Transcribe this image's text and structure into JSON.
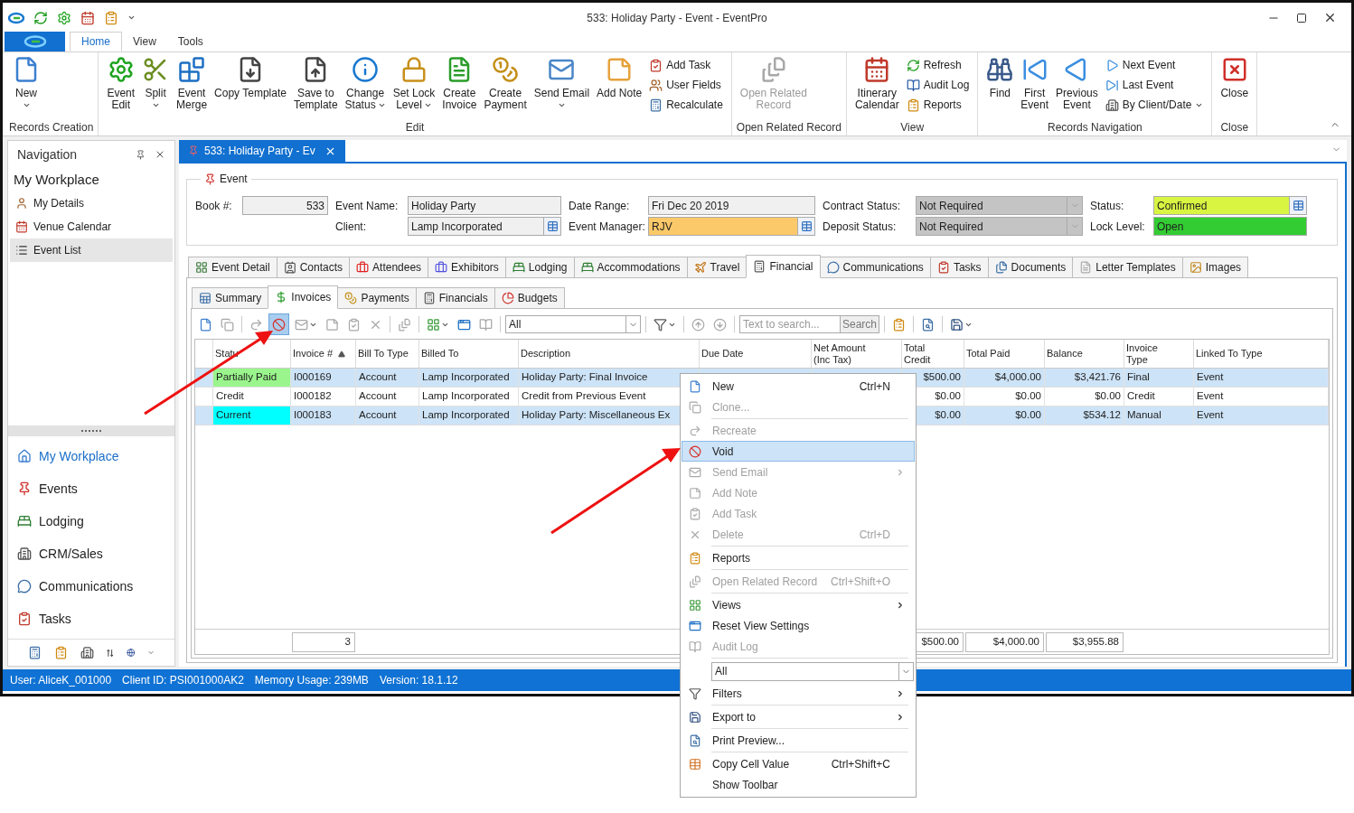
{
  "window": {
    "title": "533: Holiday Party - Event - EventPro"
  },
  "ribbon_tabs": [
    {
      "label": "Home",
      "selected": true
    },
    {
      "label": "View",
      "selected": false
    },
    {
      "label": "Tools",
      "selected": false
    }
  ],
  "ribbon_groups": [
    {
      "label": "Records Creation",
      "buttons": [
        {
          "kind": "large",
          "label": "New",
          "dropdown": true,
          "disabled": false
        }
      ]
    },
    {
      "label": "Edit",
      "buttons": [
        {
          "kind": "large",
          "label": "Event\nEdit",
          "dropdown": false,
          "disabled": false
        },
        {
          "kind": "large",
          "label": "Split",
          "dropdown": true,
          "disabled": false
        },
        {
          "kind": "large",
          "label": "Event\nMerge",
          "dropdown": false,
          "disabled": false
        },
        {
          "kind": "large",
          "label": "Copy Template",
          "dropdown": false,
          "disabled": false
        },
        {
          "kind": "large",
          "label": "Save to\nTemplate",
          "dropdown": false,
          "disabled": false
        },
        {
          "kind": "large",
          "label": "Change\nStatus",
          "dropdown": true,
          "disabled": false
        },
        {
          "kind": "large",
          "label": "Set Lock\nLevel",
          "dropdown": true,
          "disabled": false
        },
        {
          "kind": "large",
          "label": "Create\nInvoice",
          "dropdown": false,
          "disabled": false
        },
        {
          "kind": "large",
          "label": "Create\nPayment",
          "dropdown": false,
          "disabled": false
        },
        {
          "kind": "large",
          "label": "Send Email",
          "dropdown": true,
          "disabled": false
        },
        {
          "kind": "large",
          "label": "Add Note",
          "dropdown": false,
          "disabled": false
        },
        {
          "kind": "stack",
          "items": [
            {
              "label": "Add Task",
              "dropdown": false
            },
            {
              "label": "User Fields",
              "dropdown": false
            },
            {
              "label": "Recalculate",
              "dropdown": false
            }
          ]
        }
      ]
    },
    {
      "label": "Open Related Record",
      "buttons": [
        {
          "kind": "large",
          "label": "Open Related\nRecord",
          "dropdown": false,
          "disabled": true
        }
      ]
    },
    {
      "label": "View",
      "buttons": [
        {
          "kind": "large",
          "label": "Itinerary\nCalendar",
          "dropdown": false,
          "disabled": false
        },
        {
          "kind": "stack",
          "items": [
            {
              "label": "Refresh",
              "dropdown": false
            },
            {
              "label": "Audit Log",
              "dropdown": false
            },
            {
              "label": "Reports",
              "dropdown": false
            }
          ]
        }
      ]
    },
    {
      "label": "Records Navigation",
      "buttons": [
        {
          "kind": "large",
          "label": "Find",
          "dropdown": false,
          "disabled": false
        },
        {
          "kind": "large",
          "label": "First\nEvent",
          "dropdown": false,
          "disabled": false
        },
        {
          "kind": "large",
          "label": "Previous\nEvent",
          "dropdown": false,
          "disabled": false
        },
        {
          "kind": "stack",
          "items": [
            {
              "label": "Next Event",
              "dropdown": false
            },
            {
              "label": "Last Event",
              "dropdown": false
            },
            {
              "label": "By Client/Date",
              "dropdown": true
            }
          ]
        }
      ]
    },
    {
      "label": "Close",
      "buttons": [
        {
          "kind": "large",
          "label": "Close",
          "dropdown": false,
          "disabled": false
        }
      ]
    }
  ],
  "navigation": {
    "title": "Navigation",
    "heading": "My Workplace",
    "items": [
      {
        "label": "My Details",
        "selected": false
      },
      {
        "label": "Venue Calendar",
        "selected": false
      },
      {
        "label": "Event List",
        "selected": true
      }
    ],
    "modules": [
      {
        "label": "My Workplace",
        "selected": true
      },
      {
        "label": "Events",
        "selected": false
      },
      {
        "label": "Lodging",
        "selected": false
      },
      {
        "label": "CRM/Sales",
        "selected": false
      },
      {
        "label": "Communications",
        "selected": false
      },
      {
        "label": "Tasks",
        "selected": false
      }
    ]
  },
  "document_tab": {
    "label": "533: Holiday Party - Ev"
  },
  "event": {
    "legend": "Event",
    "fields": [
      {
        "label": "Book #:",
        "value": "533",
        "kind": "readonly"
      },
      {
        "label": "Event Name:",
        "value": "Holiday Party",
        "kind": "text"
      },
      {
        "label": "Date Range:",
        "value": "Fri Dec 20 2019",
        "kind": "text"
      },
      {
        "label": "Contract Status:",
        "value": "Not Required",
        "kind": "dropdown"
      },
      {
        "label": "Status:",
        "value": "Confirmed",
        "kind": "lookup",
        "color": "#d9f542"
      },
      {
        "label": "Client:",
        "value": "Lamp Incorporated",
        "kind": "lookup"
      },
      {
        "label": "Event Manager:",
        "value": "RJV",
        "kind": "lookup",
        "color": "#fcc96a"
      },
      {
        "label": "Deposit Status:",
        "value": "Not Required",
        "kind": "dropdown"
      },
      {
        "label": "Lock Level:",
        "value": "Open",
        "kind": "text",
        "color": "#33cc33"
      }
    ]
  },
  "tabs": [
    {
      "label": "Event Detail",
      "selected": false
    },
    {
      "label": "Contacts",
      "selected": false
    },
    {
      "label": "Attendees",
      "selected": false
    },
    {
      "label": "Exhibitors",
      "selected": false
    },
    {
      "label": "Lodging",
      "selected": false
    },
    {
      "label": "Accommodations",
      "selected": false
    },
    {
      "label": "Travel",
      "selected": false
    },
    {
      "label": "Financial",
      "selected": true
    },
    {
      "label": "Communications",
      "selected": false
    },
    {
      "label": "Tasks",
      "selected": false
    },
    {
      "label": "Documents",
      "selected": false
    },
    {
      "label": "Letter Templates",
      "selected": false
    },
    {
      "label": "Images",
      "selected": false
    }
  ],
  "sub_tabs": [
    {
      "label": "Summary",
      "selected": false
    },
    {
      "label": "Invoices",
      "selected": true
    },
    {
      "label": "Payments",
      "selected": false
    },
    {
      "label": "Financials",
      "selected": false
    },
    {
      "label": "Budgets",
      "selected": false
    }
  ],
  "toolbar": [
    {
      "kind": "button",
      "pressed": false,
      "disabled": false,
      "dropdown": false
    },
    {
      "kind": "button",
      "pressed": false,
      "disabled": true,
      "dropdown": false
    },
    {
      "kind": "separator"
    },
    {
      "kind": "button",
      "pressed": false,
      "disabled": true,
      "dropdown": false
    },
    {
      "kind": "button",
      "pressed": true,
      "disabled": false,
      "dropdown": false
    },
    {
      "kind": "button",
      "pressed": false,
      "disabled": true,
      "dropdown": true
    },
    {
      "kind": "button",
      "pressed": false,
      "disabled": true,
      "dropdown": false
    },
    {
      "kind": "button",
      "pressed": false,
      "disabled": true,
      "dropdown": false
    },
    {
      "kind": "button",
      "pressed": false,
      "disabled": true,
      "dropdown": false
    },
    {
      "kind": "separator"
    },
    {
      "kind": "button",
      "pressed": false,
      "disabled": true,
      "dropdown": false
    },
    {
      "kind": "separator"
    },
    {
      "kind": "button",
      "pressed": false,
      "disabled": false,
      "dropdown": true
    },
    {
      "kind": "button",
      "pressed": false,
      "disabled": false,
      "dropdown": false
    },
    {
      "kind": "button",
      "pressed": false,
      "disabled": true,
      "dropdown": false
    },
    {
      "kind": "separator"
    },
    {
      "kind": "combo",
      "value": "All"
    },
    {
      "kind": "separator"
    },
    {
      "kind": "button",
      "pressed": false,
      "disabled": false,
      "dropdown": true
    },
    {
      "kind": "separator"
    },
    {
      "kind": "button",
      "pressed": false,
      "disabled": true,
      "dropdown": false
    },
    {
      "kind": "button",
      "pressed": false,
      "disabled": true,
      "dropdown": false
    },
    {
      "kind": "separator"
    },
    {
      "kind": "search",
      "placeholder": "Text to search...",
      "button": "Search"
    },
    {
      "kind": "separator"
    },
    {
      "kind": "button",
      "pressed": false,
      "disabled": false,
      "dropdown": false
    },
    {
      "kind": "separator"
    },
    {
      "kind": "button",
      "pressed": false,
      "disabled": false,
      "dropdown": false
    },
    {
      "kind": "separator"
    },
    {
      "kind": "button",
      "pressed": false,
      "disabled": false,
      "dropdown": true
    }
  ],
  "table": {
    "columns": [
      {
        "label": "Statu",
        "sorted": false
      },
      {
        "label": "Invoice #",
        "sorted": true
      },
      {
        "label": "Bill To Type",
        "sorted": false
      },
      {
        "label": "Billed To",
        "sorted": false
      },
      {
        "label": "Description",
        "sorted": false
      },
      {
        "label": "Due Date",
        "sorted": false
      },
      {
        "label": "Net Amount\n(Inc Tax)",
        "sorted": false
      },
      {
        "label": "Total\nCredit",
        "sorted": false
      },
      {
        "label": "Total Paid",
        "sorted": false
      },
      {
        "label": "Balance",
        "sorted": false
      },
      {
        "label": "Invoice\nType",
        "sorted": false
      },
      {
        "label": "Linked To Type",
        "sorted": false
      }
    ],
    "rows": [
      {
        "selected": true,
        "color": "#9af58c",
        "cells": [
          "Partially Paid",
          "I000169",
          "Account",
          "Lamp Incorporated",
          "Holiday Party: Final Invoice",
          null,
          null,
          "$500.00",
          "$4,000.00",
          "$3,421.76",
          "Final",
          "Event"
        ]
      },
      {
        "selected": false,
        "cells": [
          "Credit",
          "I000182",
          "Account",
          "Lamp Incorporated",
          "Credit from Previous Event",
          null,
          null,
          "$0.00",
          "$0.00",
          "$0.00",
          "Credit",
          "Event"
        ]
      },
      {
        "selected": true,
        "color": "#00ffff",
        "cells": [
          "Current",
          "I000183",
          "Account",
          "Lamp Incorporated",
          "Holiday Party: Miscellaneous Ex",
          null,
          null,
          "$0.00",
          "$0.00",
          "$534.12",
          "Manual",
          "Event"
        ]
      }
    ],
    "footer": {
      "count": "3",
      "total_credit": "$500.00",
      "total_paid": "$4,000.00",
      "balance": "$3,955.88"
    }
  },
  "status_bar": [
    "User: AliceK_001000",
    "Client ID: PSI001000AK2",
    "Memory Usage: 239MB",
    "Version: 18.1.12"
  ],
  "context_menu": [
    {
      "kind": "item",
      "label": "New",
      "shortcut": "Ctrl+N",
      "disabled": false,
      "selected": false,
      "submenu": false
    },
    {
      "kind": "item",
      "label": "Clone...",
      "disabled": true,
      "selected": false,
      "submenu": false
    },
    {
      "kind": "separator"
    },
    {
      "kind": "item",
      "label": "Recreate",
      "disabled": true,
      "selected": false,
      "submenu": false
    },
    {
      "kind": "item",
      "label": "Void",
      "disabled": false,
      "selected": true,
      "submenu": false
    },
    {
      "kind": "item",
      "label": "Send Email",
      "disabled": true,
      "selected": false,
      "submenu": true
    },
    {
      "kind": "item",
      "label": "Add Note",
      "disabled": true,
      "selected": false,
      "submenu": false
    },
    {
      "kind": "item",
      "label": "Add Task",
      "disabled": true,
      "selected": false,
      "submenu": false
    },
    {
      "kind": "item",
      "label": "Delete",
      "shortcut": "Ctrl+D",
      "disabled": true,
      "selected": false,
      "submenu": false
    },
    {
      "kind": "separator"
    },
    {
      "kind": "item",
      "label": "Reports",
      "disabled": false,
      "selected": false,
      "submenu": false
    },
    {
      "kind": "separator"
    },
    {
      "kind": "item",
      "label": "Open Related Record",
      "shortcut": "Ctrl+Shift+O",
      "disabled": true,
      "selected": false,
      "submenu": false
    },
    {
      "kind": "separator"
    },
    {
      "kind": "item",
      "label": "Views",
      "disabled": false,
      "selected": false,
      "submenu": true
    },
    {
      "kind": "item",
      "label": "Reset View Settings",
      "disabled": false,
      "selected": false,
      "submenu": false
    },
    {
      "kind": "item",
      "label": "Audit Log",
      "disabled": true,
      "selected": false,
      "submenu": false
    },
    {
      "kind": "separator"
    },
    {
      "kind": "combo",
      "value": "All"
    },
    {
      "kind": "item",
      "label": "Filters",
      "disabled": false,
      "selected": false,
      "submenu": true
    },
    {
      "kind": "separator"
    },
    {
      "kind": "item",
      "label": "Export to",
      "disabled": false,
      "selected": false,
      "submenu": true
    },
    {
      "kind": "separator"
    },
    {
      "kind": "item",
      "label": "Print Preview...",
      "disabled": false,
      "selected": false,
      "submenu": false
    },
    {
      "kind": "separator"
    },
    {
      "kind": "item",
      "label": "Copy Cell Value",
      "shortcut": "Ctrl+Shift+C",
      "disabled": false,
      "selected": false,
      "submenu": false
    },
    {
      "kind": "item",
      "label": "Show Toolbar",
      "disabled": false,
      "selected": false,
      "submenu": false
    }
  ]
}
